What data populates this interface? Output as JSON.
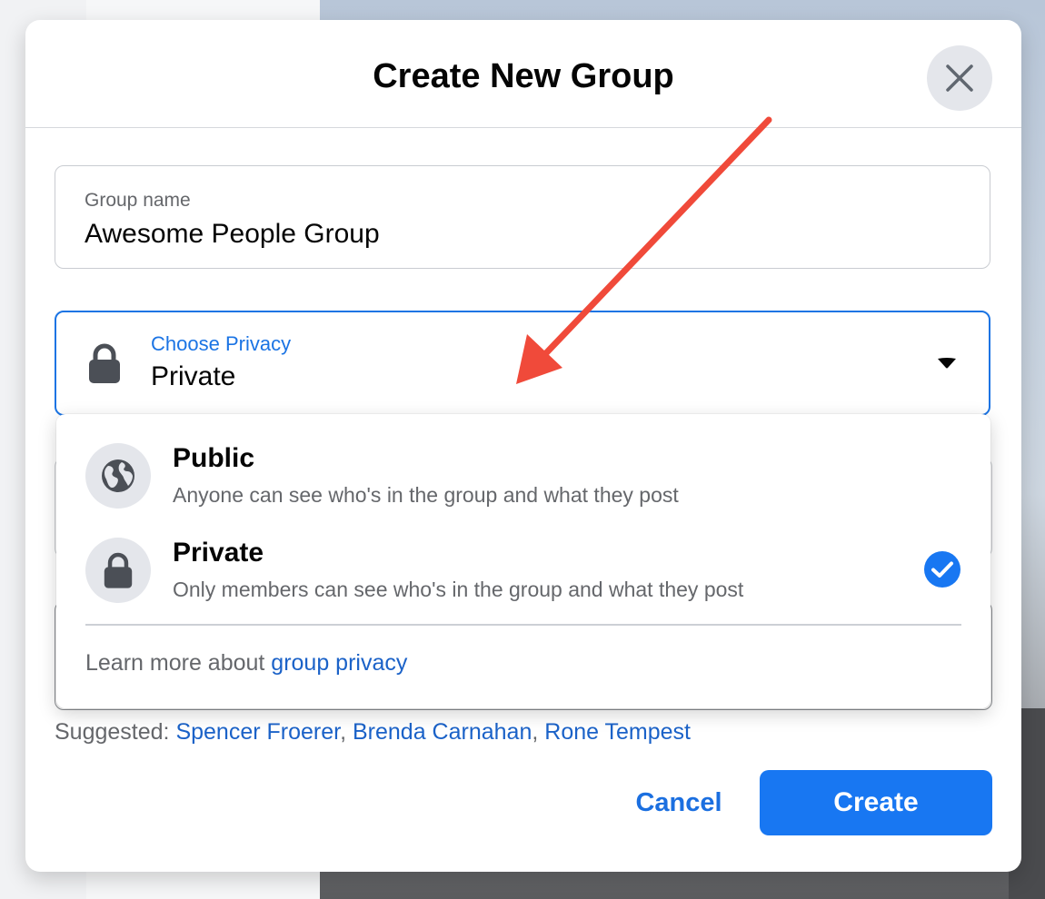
{
  "dialog": {
    "title": "Create New Group",
    "close_icon": "close-icon"
  },
  "group_name": {
    "label": "Group name",
    "value": "Awesome People Group"
  },
  "privacy": {
    "label": "Choose Privacy",
    "selected": "Private",
    "icon": "lock-icon",
    "caret_icon": "caret-down-icon"
  },
  "privacy_menu": {
    "options": [
      {
        "title": "Public",
        "description": "Anyone can see who's in the group and what they post",
        "icon": "globe-icon",
        "selected": false
      },
      {
        "title": "Private",
        "description": "Only members can see who's in the group and what they post",
        "icon": "lock-icon",
        "selected": true
      }
    ],
    "learn_more_prefix": "Learn more about ",
    "learn_more_link": "group privacy"
  },
  "suggested": {
    "prefix": "Suggested: ",
    "people": [
      "Spencer Froerer",
      "Brenda Carnahan",
      "Rone Tempest"
    ],
    "separator": ", "
  },
  "footer": {
    "cancel_label": "Cancel",
    "create_label": "Create"
  },
  "colors": {
    "accent": "#1877f2",
    "link": "#1b62c8",
    "annotation_arrow": "#f04a3a"
  }
}
